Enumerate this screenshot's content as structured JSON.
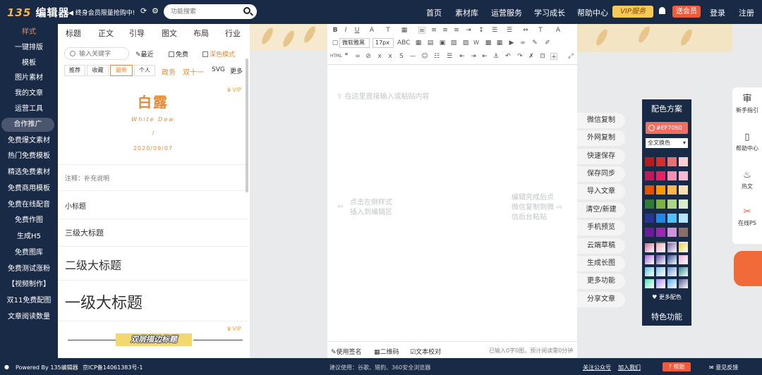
{
  "header": {
    "logo_num": "135",
    "logo_text": "编辑器",
    "promo": "终身会员限量抢购中!",
    "search_placeholder": "功能搜索",
    "nav": [
      "首页",
      "素材库",
      "运营服务",
      "学习成长",
      "帮助中心"
    ],
    "vip": "VIP服务",
    "send_vip": "送会员",
    "login": "登录",
    "register": "注册"
  },
  "sidebar": {
    "items": [
      "样式",
      "一键排版",
      "模板",
      "图片素材",
      "我的文章",
      "运营工具",
      "合作推广",
      "免费爆文素材",
      "热门免费模板",
      "精选免费素材",
      "免费商用模板",
      "免费在线配音",
      "免费作图",
      "生成H5",
      "免费图库",
      "免费测试涨粉",
      "【视频制作】",
      "双11免费配图",
      "文章阅读数量"
    ]
  },
  "panel": {
    "tabs": [
      "标题",
      "正文",
      "引导",
      "图文",
      "布局",
      "行业"
    ],
    "keyword_placeholder": "输入关键字",
    "recent": "最近",
    "free": "免费",
    "dark_mode": "深色模式",
    "subtabs": [
      "推荐",
      "收藏",
      "最新",
      "个人"
    ],
    "links": [
      "政务",
      "双十一",
      "SVG",
      "更多"
    ],
    "card": {
      "title": "白露",
      "subtitle": "White Dew",
      "slash": "/",
      "date": "2020/09/07",
      "badge": "VIP"
    },
    "note": "注释：补充说明",
    "small_title": "小标题",
    "level3": "三级大标题",
    "level2": "二级大标题",
    "level1": "一级大标题",
    "double_title": "双层描边标题",
    "double_badge": "VIP"
  },
  "editor": {
    "font": "微软雅黑",
    "size": "17px",
    "placeholder": "在这里直接输入或粘贴内容",
    "hint_left": [
      "点击左侧样式",
      "插入到编辑区"
    ],
    "hint_right": [
      "编辑完成后点",
      "微信复制到微",
      "信后台粘贴"
    ],
    "bottom": {
      "sign": "使用签名",
      "qrcode": "二维码",
      "proof": "文本校对",
      "status": "已输入0字0图，预计阅读需0分钟"
    }
  },
  "actions": [
    "微信复制",
    "外网复制",
    "快速保存",
    "保存同步",
    "导入文章",
    "清空/新建",
    "手机预览",
    "云端草稿",
    "生成长图",
    "更多功能",
    "分享文章"
  ],
  "palette": {
    "title": "配色方案",
    "hex": "#EF7060",
    "select": "全文换色",
    "more": "更多配色",
    "feature": "特色功能",
    "swatches": [
      "#b71c1c",
      "#d32f2f",
      "#e57373",
      "#ffcdd2",
      "#c2185b",
      "#e91e63",
      "#f48fb1",
      "#f8bbd0",
      "#e65100",
      "#ff9800",
      "#ffb74d",
      "#ffe0b2",
      "#2e7d32",
      "#7cb342",
      "#aed581",
      "#dcedc8",
      "#283593",
      "#1e88e5",
      "#4fc3f7",
      "#b3e5fc",
      "#6a1b9a",
      "#9c27b0",
      "#ce93d8",
      "#8d6e63",
      "#212121",
      "#616161",
      "#bdbdbd",
      "#eeeeee"
    ],
    "gradients": [
      [
        "#d06b9a",
        "#f7a6b0",
        "#7f5fa8",
        "#f4d03f"
      ],
      [
        "#a06cd5",
        "#5d4ba3",
        "#2d4a8a",
        "#e8b0d0"
      ],
      [
        "#5ec2d8",
        "#7cc4e8",
        "#6a8fd0",
        "#2e8b8b"
      ],
      [
        "#4fe0b0",
        "#a78bfa",
        "#5ab0f0",
        "#5a5f8a"
      ]
    ]
  },
  "rightbar": [
    "新手指引",
    "帮助中心",
    "热文",
    "在线PS"
  ],
  "footer": {
    "powered": "Powered By 135编辑器",
    "icp": "京ICP备14061383号-1",
    "suggest": "建议使用：谷歌、猎豹、360安全浏览器",
    "follow": "关注公众号",
    "join": "加入我们",
    "help": "帮助",
    "feedback": "意见反馈"
  },
  "colors": {
    "navy": "#192a46",
    "accent": "#e08a3c",
    "red": "#f05a3a",
    "vip": "#f5c955"
  }
}
